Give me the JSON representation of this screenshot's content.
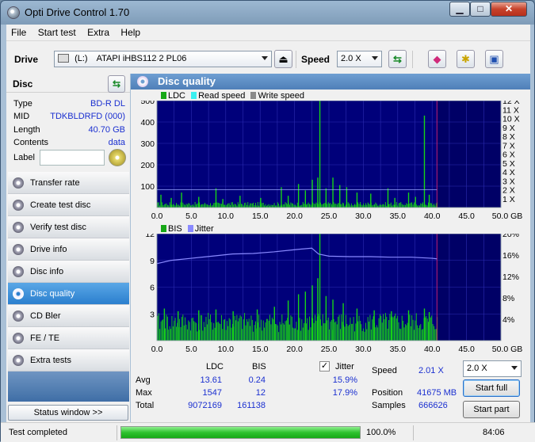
{
  "window": {
    "title": "Opti Drive Control 1.70"
  },
  "menu": [
    "File",
    "Start test",
    "Extra",
    "Help"
  ],
  "toolbar": {
    "drive_label": "Drive",
    "drive_letter": "(L:)",
    "drive_value": "ATAPI iHBS112  2 PL06",
    "speed_label": "Speed",
    "speed_value": "2.0 X"
  },
  "disc": {
    "title": "Disc",
    "type_label": "Type",
    "type_value": "BD-R DL",
    "mid_label": "MID",
    "mid_value": "TDKBLDRFD (000)",
    "length_label": "Length",
    "length_value": "40.70 GB",
    "contents_label": "Contents",
    "contents_value": "data",
    "label_label": "Label"
  },
  "nav": [
    {
      "label": "Transfer rate",
      "active": false
    },
    {
      "label": "Create test disc",
      "active": false
    },
    {
      "label": "Verify test disc",
      "active": false
    },
    {
      "label": "Drive info",
      "active": false
    },
    {
      "label": "Disc info",
      "active": false
    },
    {
      "label": "Disc quality",
      "active": true
    },
    {
      "label": "CD Bler",
      "active": false
    },
    {
      "label": "FE / TE",
      "active": false
    },
    {
      "label": "Extra tests",
      "active": false
    }
  ],
  "status_window_label": "Status window >>",
  "panel": {
    "title": "Disc quality",
    "legend_top": {
      "ldc": "LDC",
      "read": "Read speed",
      "write": "Write speed"
    },
    "legend_bottom": {
      "bis": "BIS",
      "jitter": "Jitter"
    }
  },
  "colors": {
    "plot_bg": "#00007a",
    "plot_bg_unused": "#000066",
    "bar_green": "#17d317",
    "jitter_line": "#8a8aff",
    "grid": "#2c2cb0",
    "end_marker": "#c42070"
  },
  "chart_data": [
    {
      "type": "bar",
      "name": "LDC chart",
      "x_ticks": [
        "0.0",
        "5.0",
        "10.0",
        "15.0",
        "20.0",
        "25.0",
        "30.0",
        "35.0",
        "40.0",
        "45.0",
        "50.0 GB"
      ],
      "xlim": [
        0,
        50
      ],
      "y_ticks_left": [
        "500",
        "400",
        "300",
        "200",
        "100"
      ],
      "ylim": [
        0,
        500
      ],
      "y_ticks_right": [
        "12 X",
        "11 X",
        "10 X",
        "9 X",
        "8 X",
        "7 X",
        "6 X",
        "5 X",
        "4 X",
        "3 X",
        "2 X",
        "1 X"
      ],
      "data_extent_gb": 40.7,
      "baseline": 20,
      "spikes": [
        [
          0.5,
          60
        ],
        [
          2,
          45
        ],
        [
          3.5,
          70
        ],
        [
          6,
          50
        ],
        [
          8.5,
          90
        ],
        [
          9.5,
          40
        ],
        [
          12,
          55
        ],
        [
          15,
          45
        ],
        [
          18,
          95
        ],
        [
          19,
          55
        ],
        [
          20.5,
          110
        ],
        [
          21.5,
          80
        ],
        [
          22.5,
          130
        ],
        [
          23.3,
          140
        ],
        [
          23.6,
          500
        ],
        [
          24.5,
          90
        ],
        [
          25.5,
          140
        ],
        [
          26.5,
          105
        ],
        [
          27.5,
          95
        ],
        [
          29,
          70
        ],
        [
          31,
          65
        ],
        [
          33.5,
          90
        ],
        [
          34.5,
          45
        ],
        [
          36.5,
          70
        ],
        [
          37.5,
          50
        ],
        [
          38.8,
          430
        ],
        [
          39.5,
          60
        ]
      ],
      "read_speed_x": 2.0
    },
    {
      "type": "bar",
      "name": "BIS / Jitter chart",
      "x_ticks": [
        "0.0",
        "5.0",
        "10.0",
        "15.0",
        "20.0",
        "25.0",
        "30.0",
        "35.0",
        "40.0",
        "45.0",
        "50.0 GB"
      ],
      "xlim": [
        0,
        50
      ],
      "y_ticks_left": [
        "12",
        "9",
        "6",
        "3"
      ],
      "ylim": [
        0,
        12
      ],
      "y_ticks_right": [
        "20%",
        "16%",
        "12%",
        "8%",
        "4%"
      ],
      "data_extent_gb": 40.7,
      "baseline": 2.4,
      "spikes": [
        [
          1,
          3.6
        ],
        [
          3,
          3.3
        ],
        [
          6,
          3.4
        ],
        [
          8.5,
          3.5
        ],
        [
          11,
          3.3
        ],
        [
          14.5,
          3.5
        ],
        [
          17,
          3.8
        ],
        [
          19,
          4.5
        ],
        [
          20.5,
          5.2
        ],
        [
          21.5,
          5.5
        ],
        [
          22.5,
          6.2
        ],
        [
          23.3,
          7
        ],
        [
          23.6,
          12
        ],
        [
          24.5,
          5
        ],
        [
          25.5,
          4.6
        ],
        [
          27,
          4.2
        ],
        [
          29,
          3.6
        ],
        [
          31.5,
          3.4
        ],
        [
          34,
          3.3
        ],
        [
          36.5,
          3.4
        ],
        [
          38.8,
          3.6
        ],
        [
          39.5,
          3.2
        ]
      ],
      "jitter_percent": [
        [
          0,
          14.4
        ],
        [
          2,
          15.0
        ],
        [
          5,
          15.4
        ],
        [
          8,
          15.8
        ],
        [
          11,
          16.2
        ],
        [
          14,
          16.3
        ],
        [
          17,
          16.6
        ],
        [
          20,
          17.0
        ],
        [
          22.5,
          17.3
        ],
        [
          23.5,
          16.2
        ],
        [
          25,
          15.8
        ],
        [
          28,
          15.7
        ],
        [
          31,
          15.7
        ],
        [
          34,
          15.6
        ],
        [
          37,
          15.6
        ],
        [
          40,
          15.4
        ],
        [
          40.7,
          15.3
        ]
      ]
    }
  ],
  "stats": {
    "col_ldc": "LDC",
    "col_bis": "BIS",
    "col_jitter": "Jitter",
    "jitter_checked": true,
    "avg_label": "Avg",
    "avg_ldc": "13.61",
    "avg_bis": "0.24",
    "avg_jitter": "15.9%",
    "max_label": "Max",
    "max_ldc": "1547",
    "max_bis": "12",
    "max_jitter": "17.9%",
    "total_label": "Total",
    "total_ldc": "9072169",
    "total_bis": "161138",
    "speed_label": "Speed",
    "speed_value": "2.01 X",
    "position_label": "Position",
    "position_value": "41675 MB",
    "samples_label": "Samples",
    "samples_value": "666626",
    "speed_select": "2.0 X",
    "start_full": "Start full",
    "start_part": "Start part"
  },
  "statusbar": {
    "text": "Test completed",
    "progress_percent": 100,
    "progress_text": "100.0%",
    "time": "84:06"
  }
}
